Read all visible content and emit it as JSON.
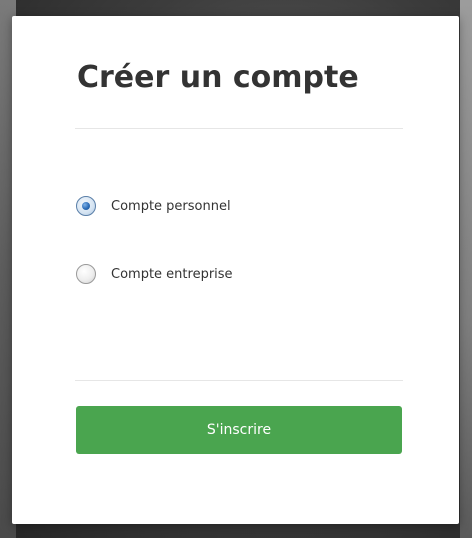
{
  "modal": {
    "title": "Créer un compte",
    "account_type": {
      "options": [
        {
          "label": "Compte personnel",
          "checked": true
        },
        {
          "label": "Compte entreprise",
          "checked": false
        }
      ]
    },
    "submit_label": "S'inscrire"
  },
  "colors": {
    "submit_background": "#4aa54f",
    "title_text": "#333333"
  }
}
